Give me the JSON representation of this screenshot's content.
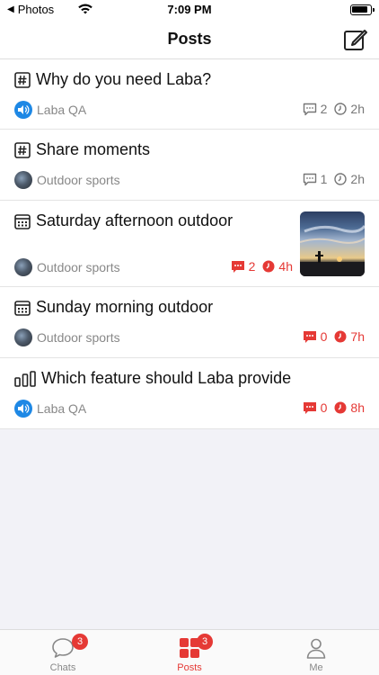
{
  "status_bar": {
    "back_label": "Photos",
    "time": "7:09 PM"
  },
  "nav": {
    "title": "Posts"
  },
  "posts": [
    {
      "title": "Why do you need Laba?",
      "type_icon": "hashtag-icon",
      "author": "Laba QA",
      "avatar": "speaker-avatar",
      "comments": "2",
      "time": "2h",
      "highlight": false,
      "has_image": false
    },
    {
      "title": "Share moments",
      "type_icon": "hashtag-icon",
      "author": "Outdoor sports",
      "avatar": "photo-avatar",
      "comments": "1",
      "time": "2h",
      "highlight": false,
      "has_image": false
    },
    {
      "title": "Saturday afternoon outdoor",
      "type_icon": "calendar-icon",
      "author": "Outdoor sports",
      "avatar": "photo-avatar",
      "comments": "2",
      "time": "4h",
      "highlight": true,
      "has_image": true
    },
    {
      "title": "Sunday morning outdoor",
      "type_icon": "calendar-icon",
      "author": "Outdoor sports",
      "avatar": "photo-avatar",
      "comments": "0",
      "time": "7h",
      "highlight": true,
      "has_image": false
    },
    {
      "title": "Which feature should Laba provide",
      "type_icon": "poll-icon",
      "author": "Laba QA",
      "avatar": "speaker-avatar",
      "comments": "0",
      "time": "8h",
      "highlight": true,
      "has_image": false
    }
  ],
  "tabs": [
    {
      "label": "Chats",
      "badge": "3",
      "active": false,
      "icon": "chat-bubble-icon"
    },
    {
      "label": "Posts",
      "badge": "3",
      "active": true,
      "icon": "grid-icon"
    },
    {
      "label": "Me",
      "badge": "",
      "active": false,
      "icon": "person-icon"
    }
  ],
  "colors": {
    "accent": "#e53935",
    "qa_avatar": "#1e88e5",
    "meta_gray": "#888888"
  }
}
